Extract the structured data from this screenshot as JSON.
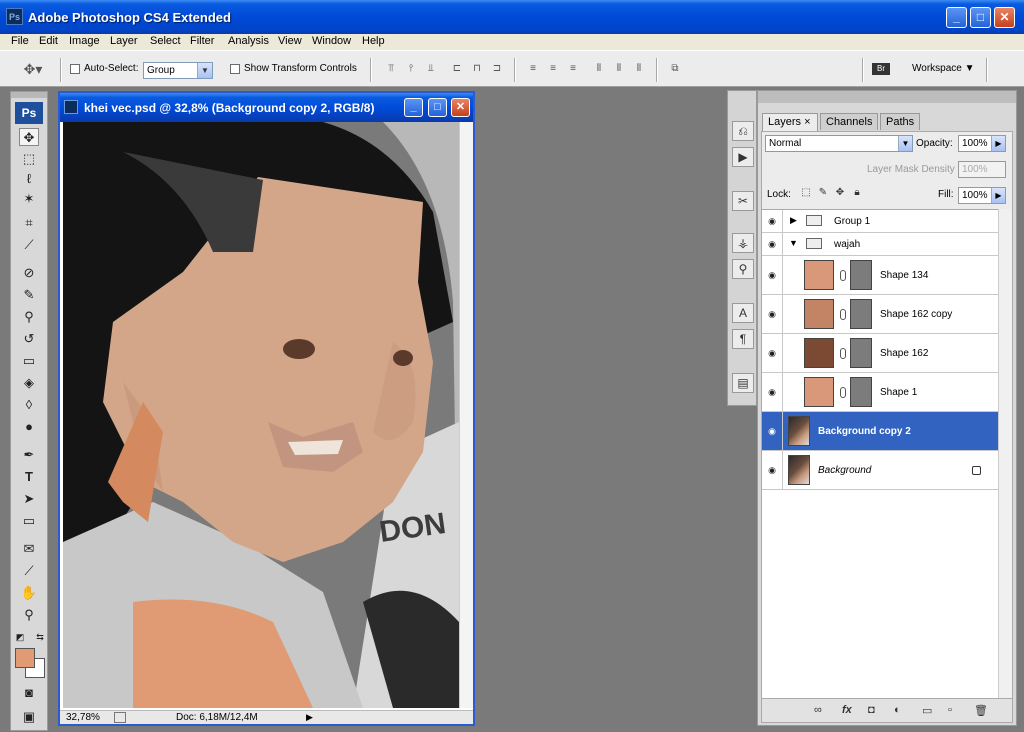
{
  "app": {
    "title": "Adobe Photoshop CS4 Extended",
    "logo_text": "Ps"
  },
  "window_controls": {
    "minimize": "_",
    "maximize": "□",
    "close": "✕"
  },
  "menubar": [
    "File",
    "Edit",
    "Image",
    "Layer",
    "Select",
    "Filter",
    "Analysis",
    "View",
    "Window",
    "Help"
  ],
  "options": {
    "auto_select_label": "Auto-Select:",
    "auto_select_checked": false,
    "auto_select_value": "Group",
    "show_transform_label": "Show Transform Controls",
    "show_transform_checked": false,
    "workspace_label": "Workspace ▼"
  },
  "toolbox": {
    "logo": "Ps",
    "tools": [
      "move-tool",
      "marquee-tool",
      "lasso-tool",
      "magic-wand-tool",
      "crop-tool",
      "eyedropper-tool",
      "healing-brush-tool",
      "brush-tool",
      "clone-stamp-tool",
      "history-brush-tool",
      "eraser-tool",
      "paint-bucket-tool",
      "blur-tool",
      "dodge-tool",
      "pen-tool",
      "type-tool",
      "path-selection-tool",
      "shape-tool",
      "notes-tool",
      "eyedropper2-tool",
      "hand-tool",
      "zoom-tool"
    ],
    "foreground_color": "#e09a74",
    "background_color": "#ffffff"
  },
  "document": {
    "title": "khei vec.psd @ 32,8% (Background copy 2, RGB/8)",
    "zoom": "32,78%",
    "doc_size": "Doc: 6,18M/12,4M"
  },
  "layers_panel": {
    "tabs": [
      "Layers",
      "Channels",
      "Paths"
    ],
    "active_tab": "Layers",
    "tab_close": "×",
    "blend_mode": "Normal",
    "opacity_label": "Opacity:",
    "opacity_value": "100%",
    "mask_density_label": "Layer Mask Density",
    "lock_label": "Lock:",
    "fill_label": "Fill:",
    "fill_value": "100%",
    "layers": [
      {
        "name": "Group 1",
        "type": "group",
        "expanded": false,
        "visible": true
      },
      {
        "name": "wajah",
        "type": "group",
        "expanded": true,
        "visible": true
      },
      {
        "name": "Shape 134",
        "type": "shape",
        "color": "#d9987a",
        "visible": true
      },
      {
        "name": "Shape 162 copy",
        "type": "shape",
        "color": "#c28464",
        "visible": true
      },
      {
        "name": "Shape 162",
        "type": "shape",
        "color": "#7c4a32",
        "visible": true
      },
      {
        "name": "Shape 1",
        "type": "shape",
        "color": "#d9987a",
        "visible": true
      },
      {
        "name": "Background copy 2",
        "type": "pixel",
        "selected": true,
        "visible": true
      },
      {
        "name": "Background",
        "type": "pixel",
        "locked": true,
        "visible": true
      }
    ]
  }
}
